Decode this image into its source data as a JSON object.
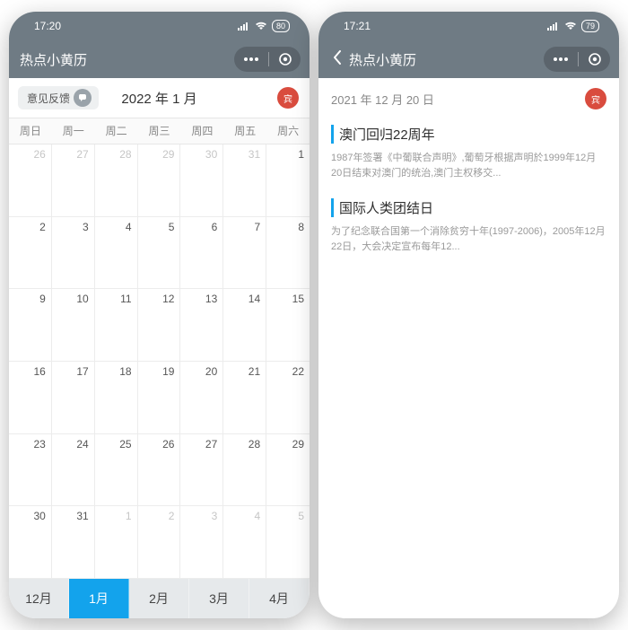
{
  "left": {
    "status_time": "17:20",
    "battery": "80",
    "app_title": "热点小黄历",
    "feedback_label": "意见反馈",
    "month_label": "2022 年 1 月",
    "badge_char": "宾",
    "dow": [
      "周日",
      "周一",
      "周二",
      "周三",
      "周四",
      "周五",
      "周六"
    ],
    "cells": [
      {
        "n": "26",
        "out": true
      },
      {
        "n": "27",
        "out": true
      },
      {
        "n": "28",
        "out": true
      },
      {
        "n": "29",
        "out": true
      },
      {
        "n": "30",
        "out": true
      },
      {
        "n": "31",
        "out": true
      },
      {
        "n": "1"
      },
      {
        "n": "2"
      },
      {
        "n": "3"
      },
      {
        "n": "4"
      },
      {
        "n": "5"
      },
      {
        "n": "6"
      },
      {
        "n": "7"
      },
      {
        "n": "8"
      },
      {
        "n": "9"
      },
      {
        "n": "10"
      },
      {
        "n": "11"
      },
      {
        "n": "12"
      },
      {
        "n": "13"
      },
      {
        "n": "14"
      },
      {
        "n": "15"
      },
      {
        "n": "16"
      },
      {
        "n": "17"
      },
      {
        "n": "18"
      },
      {
        "n": "19"
      },
      {
        "n": "20"
      },
      {
        "n": "21"
      },
      {
        "n": "22"
      },
      {
        "n": "23"
      },
      {
        "n": "24"
      },
      {
        "n": "25"
      },
      {
        "n": "26"
      },
      {
        "n": "27"
      },
      {
        "n": "28"
      },
      {
        "n": "29"
      },
      {
        "n": "30"
      },
      {
        "n": "31"
      },
      {
        "n": "1",
        "out": true
      },
      {
        "n": "2",
        "out": true
      },
      {
        "n": "3",
        "out": true
      },
      {
        "n": "4",
        "out": true
      },
      {
        "n": "5",
        "out": true
      }
    ],
    "tabs": [
      "12月",
      "1月",
      "2月",
      "3月",
      "4月"
    ],
    "active_tab": 1
  },
  "right": {
    "status_time": "17:21",
    "battery": "79",
    "app_title": "热点小黄历",
    "date_label": "2021 年 12 月 20 日",
    "badge_char": "宾",
    "articles": [
      {
        "title": "澳门回归22周年",
        "desc": "1987年签署《中葡联合声明》,葡萄牙根据声明於1999年12月20日结束对澳门的统治,澳门主权移交..."
      },
      {
        "title": "国际人类团结日",
        "desc": "为了纪念联合国第一个消除贫穷十年(1997-2006)，2005年12月22日，大会决定宣布每年12..."
      }
    ]
  }
}
